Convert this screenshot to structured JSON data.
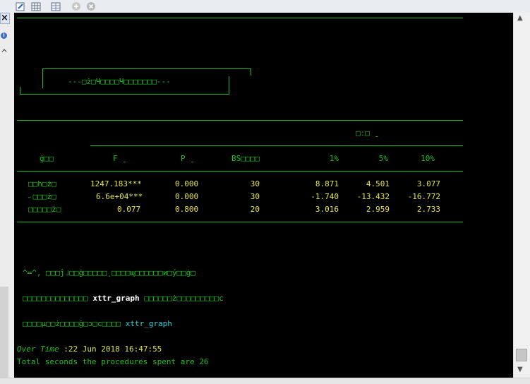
{
  "toolbar": {
    "icons": [
      "edit-icon",
      "table-icon",
      "grid-icon",
      "add-circle-icon",
      "close-circle-icon"
    ]
  },
  "side": {
    "close_glyph": "×",
    "info_glyph": "i",
    "up_glyph": "^"
  },
  "scroll": {
    "up": "▲",
    "down": "▼"
  },
  "banner": "---□ż□Ч□□□□Ч□□□□□□□---",
  "table": {
    "group_header": "□ː□ ˍ",
    "col_var": "ġ□□",
    "col_f": "F ˍ",
    "col_p": "P ˍ",
    "col_bs": "BS□□□□",
    "col_1": "1%",
    "col_5": "5%",
    "col_10": "10%",
    "rows": [
      {
        "name": "□□h□ż□",
        "f": "1247.183***",
        "p": "0.000",
        "bs": "30",
        "c1": "8.871",
        "c5": "4.501",
        "c10": "3.077"
      },
      {
        "name": "˶□□□ż□",
        "f": "6.6e+04***",
        "p": "0.000",
        "bs": "30",
        "c1": "-1.740",
        "c5": "-13.432",
        "c10": "-16.772"
      },
      {
        "name": "□□□□□ż□",
        "f": "0.077",
        "p": "0.800",
        "bs": "20",
        "c1": "3.016",
        "c5": "2.959",
        "c10": "2.733"
      }
    ]
  },
  "notes": {
    "line1": "^=^, □□□ĵ˩□□ġ□□□□□¸□□□□ɰ□□□□□□и□ý□□ġ□",
    "line2_pre": "□□□□□□□□□□□□□□ ",
    "line2_cmd": "xttr_graph",
    "line2_post": " □□□□□□ż□□□□□□□□□с",
    "line3_pre": "□□□□µ□□ż□□□□ġ□ɔ□с□□□□ ",
    "line3_cmd": "xttr_graph"
  },
  "footer": {
    "over_label": "Over Time ",
    "over_value": ":22 Jun 2018 16:47:55",
    "total": "Total seconds the procedures spent are 26"
  }
}
